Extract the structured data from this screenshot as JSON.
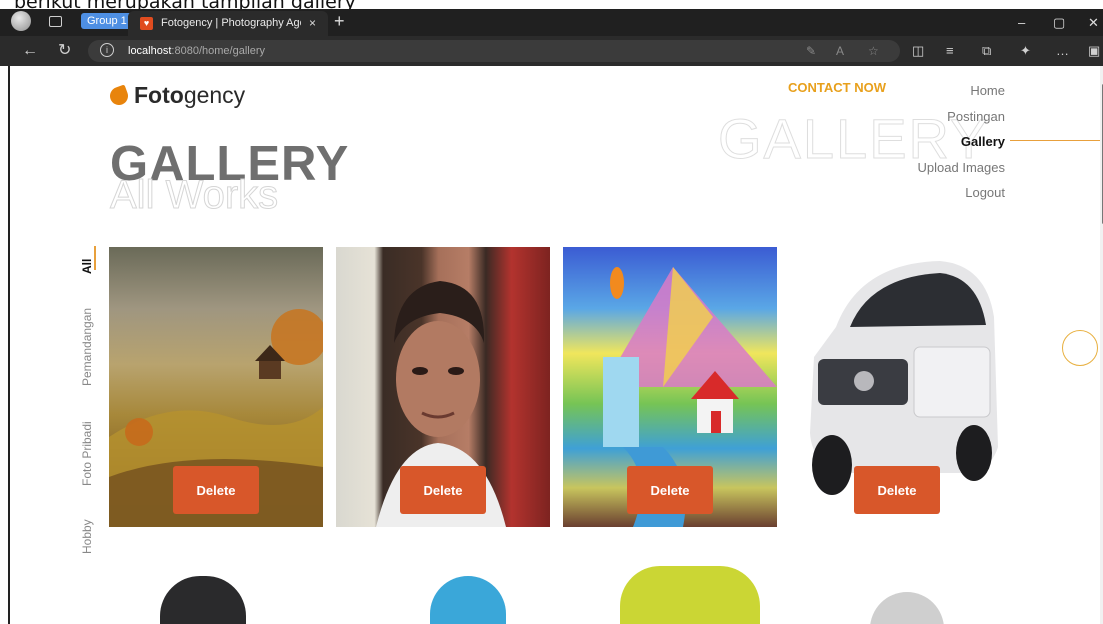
{
  "caption": "berikut merupakan tampilan gallery",
  "browser": {
    "group_label": "Group 1",
    "tab_title": "Fotogency | Photography Agency",
    "tab_close": "×",
    "new_tab": "+",
    "url_host": "localhost",
    "url_rest": ":8080/home/gallery",
    "window_controls": [
      "–",
      "▢",
      "✕"
    ],
    "icons": [
      "back-arrow-icon",
      "refresh-icon",
      "info-icon",
      "read-aloud-icon",
      "favorite-star-icon",
      "split-screen-icon",
      "favorites-list-icon",
      "collections-icon",
      "extensions-icon",
      "more-icon",
      "sidebar-icon"
    ]
  },
  "site": {
    "logo_bold": "Foto",
    "logo_rest": "gency",
    "contact": "CONTACT NOW",
    "menu": [
      {
        "label": "Home",
        "active": false
      },
      {
        "label": "Postingan",
        "active": false
      },
      {
        "label": "Gallery",
        "active": true
      },
      {
        "label": "Upload Images",
        "active": false
      },
      {
        "label": "Logout",
        "active": false
      }
    ],
    "bg_word": "GALLERY",
    "title": "GALLERY",
    "subtitle": "All Works",
    "filters": [
      "All",
      "Pemandangan",
      "Foto Pribadi",
      "Hobby"
    ],
    "delete_label": "Delete",
    "accent": "#e8a03c",
    "button_color": "#d8572a"
  }
}
